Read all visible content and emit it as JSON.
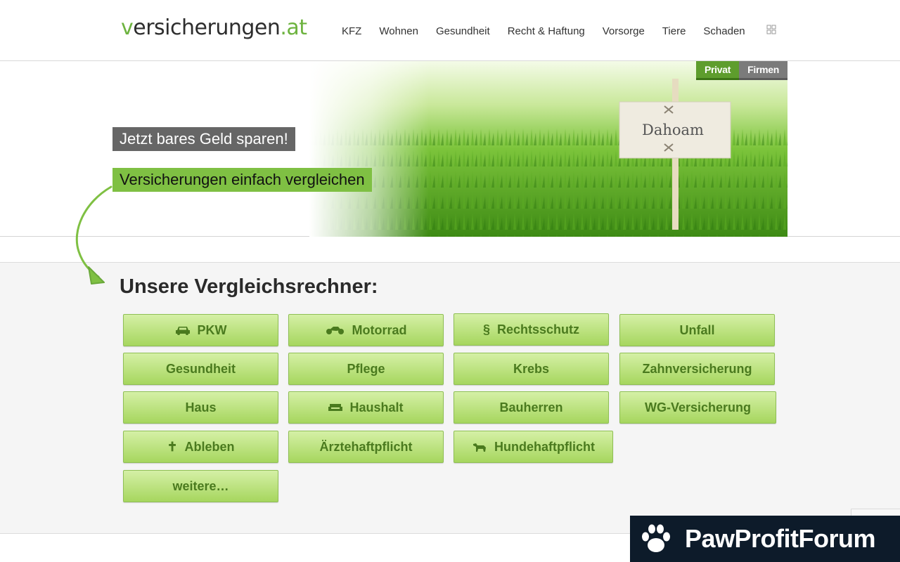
{
  "header": {
    "logo": {
      "prefix": "v",
      "main": "ersicherungen",
      "tld": ".at"
    },
    "nav": [
      "KFZ",
      "Wohnen",
      "Gesundheit",
      "Recht & Haftung",
      "Vorsorge",
      "Tiere",
      "Schaden"
    ],
    "grid_icon": "grid-icon"
  },
  "hero": {
    "tabs": {
      "privat": "Privat",
      "firmen": "Firmen"
    },
    "tagline_1": "Jetzt bares Geld sparen!",
    "tagline_2": "Versicherungen einfach vergleichen",
    "sign_text": "Dahoam"
  },
  "section": {
    "title": "Unsere Vergleichsrechner:",
    "buttons": {
      "pkw": "PKW",
      "motorrad": "Motorrad",
      "rechtsschutz": "Rechtsschutz",
      "rechtsschutz_symbol": "§",
      "unfall": "Unfall",
      "gesundheit": "Gesundheit",
      "pflege": "Pflege",
      "krebs": "Krebs",
      "zahn": "Zahnversicherung",
      "haus": "Haus",
      "haushalt": "Haushalt",
      "bauherren": "Bauherren",
      "wg": "WG-Versicherung",
      "ableben": "Ableben",
      "ableben_symbol": "✝",
      "aerzte": "Ärztehaftpflicht",
      "hunde": "Hundehaftpflicht",
      "weitere": "weitere…"
    }
  },
  "watermark": {
    "text": "PawProfitForum"
  },
  "colors": {
    "accent_green": "#6db33f",
    "button_text": "#4a7a1e",
    "watermark_bg": "#0d1b2a"
  }
}
